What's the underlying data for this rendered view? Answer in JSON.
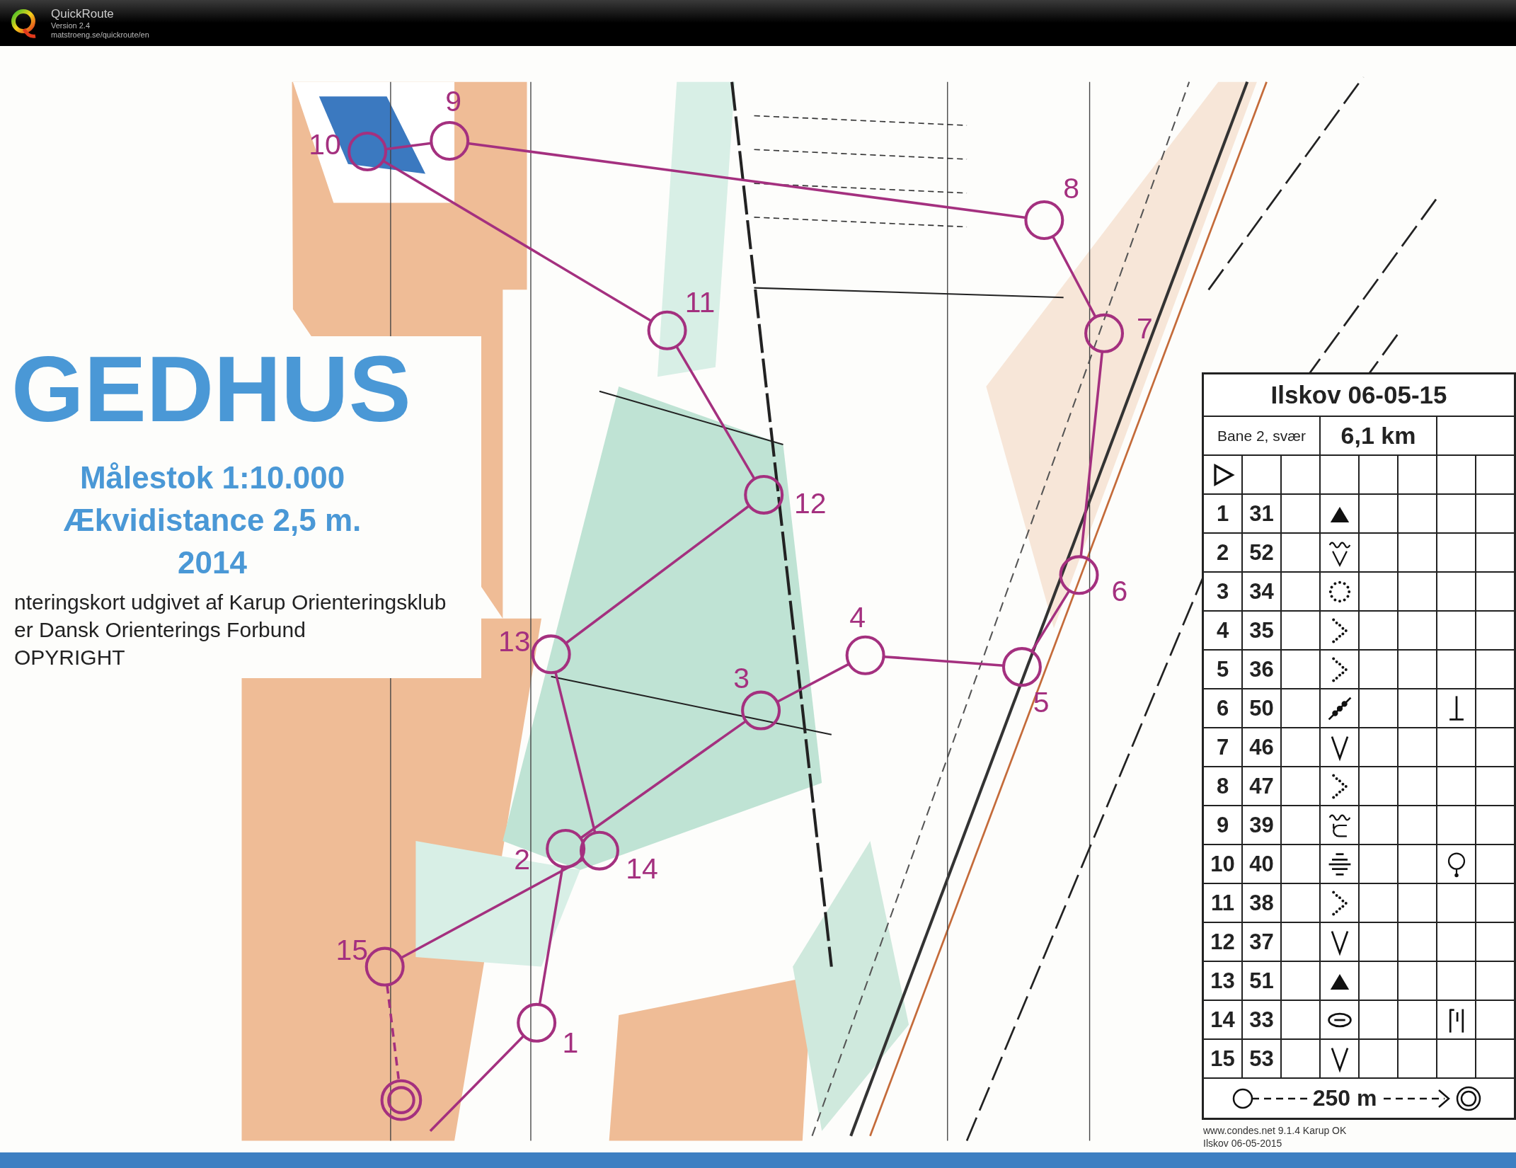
{
  "app": {
    "name": "QuickRoute",
    "version": "Version 2.4",
    "url": "matstroeng.se/quickroute/en"
  },
  "map": {
    "title": "GEDHUS",
    "info": [
      "Målestok 1:10.000",
      "Ækvidistance 2,5 m.",
      "2014"
    ],
    "credits": [
      "nteringskort udgivet af Karup Orienteringsklub",
      "er Dansk Orienterings Forbund",
      "OPYRIGHT"
    ],
    "controls": [
      {
        "number": "1"
      },
      {
        "number": "2"
      },
      {
        "number": "3"
      },
      {
        "number": "4"
      },
      {
        "number": "5"
      },
      {
        "number": "6"
      },
      {
        "number": "7"
      },
      {
        "number": "8"
      },
      {
        "number": "9"
      },
      {
        "number": "10"
      },
      {
        "number": "11"
      },
      {
        "number": "12"
      },
      {
        "number": "13"
      },
      {
        "number": "14"
      },
      {
        "number": "15"
      }
    ]
  },
  "description": {
    "event": "Ilskov 06-05-15",
    "course": "Bane 2, svær",
    "length": "6,1 km",
    "rows": [
      {
        "number": "1",
        "code": "31",
        "symbol": {
          "kind": "triangle"
        }
      },
      {
        "number": "2",
        "code": "52",
        "symbol": {
          "kind": "wave-v"
        }
      },
      {
        "number": "3",
        "code": "34",
        "symbol": {
          "kind": "dotted-circle"
        }
      },
      {
        "number": "4",
        "code": "35",
        "symbol": {
          "kind": "dotted-v"
        }
      },
      {
        "number": "5",
        "code": "36",
        "symbol": {
          "kind": "dotted-v"
        }
      },
      {
        "number": "6",
        "code": "50",
        "symbol": {
          "kind": "beaded-line"
        },
        "detail": {
          "kind": "tee"
        }
      },
      {
        "number": "7",
        "code": "46",
        "symbol": {
          "kind": "v"
        }
      },
      {
        "number": "8",
        "code": "47",
        "symbol": {
          "kind": "dotted-v"
        }
      },
      {
        "number": "9",
        "code": "39",
        "symbol": {
          "kind": "wave-u"
        }
      },
      {
        "number": "10",
        "code": "40",
        "symbol": {
          "kind": "lines"
        },
        "detail": {
          "kind": "lollipop"
        }
      },
      {
        "number": "11",
        "code": "38",
        "symbol": {
          "kind": "dotted-v"
        }
      },
      {
        "number": "12",
        "code": "37",
        "symbol": {
          "kind": "v"
        }
      },
      {
        "number": "13",
        "code": "51",
        "symbol": {
          "kind": "triangle"
        }
      },
      {
        "number": "14",
        "code": "33",
        "symbol": {
          "kind": "ellipse"
        },
        "detail": {
          "kind": "bars"
        }
      },
      {
        "number": "15",
        "code": "53",
        "symbol": {
          "kind": "v"
        }
      }
    ],
    "distance": "250 m",
    "footer": [
      "www.condes.net 9.1.4 Karup OK",
      "Ilskov 06-05-2015"
    ]
  }
}
